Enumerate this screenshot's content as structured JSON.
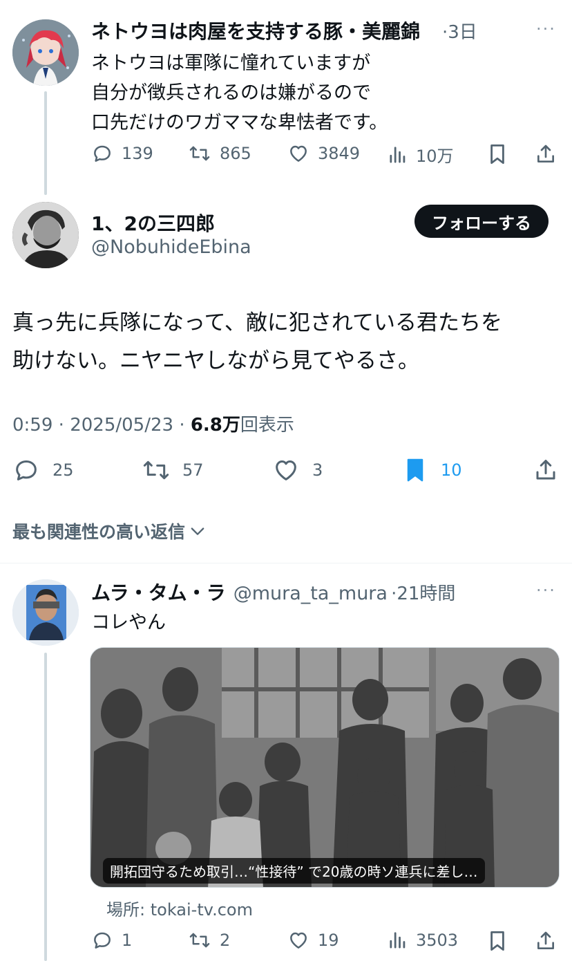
{
  "reply1": {
    "display_name": "ネトウヨは肉屋を支持する豚・美麗錦",
    "time": "3日",
    "more": "···",
    "text_lines": [
      "ネトウヨは軍隊に憧れていますが",
      "自分が徴兵されるのは嫌がるので",
      "口先だけのワガママな卑怯者です。"
    ],
    "replies": "139",
    "reposts": "865",
    "likes": "3849",
    "views": "10万"
  },
  "main": {
    "display_name": "1、2の三四郎",
    "handle": "@NobuhideEbina",
    "follow_label": "フォローする",
    "text_lines": [
      "真っ先に兵隊になって、敵に犯されている君たちを",
      "助けない。ニヤニヤしながら見てやるさ。"
    ],
    "time": "0:59",
    "date": "2025/05/23",
    "views_count": "6.8万",
    "views_label": "回表示",
    "replies": "25",
    "reposts": "57",
    "likes": "3",
    "bookmarks": "10",
    "bookmark_color": "#1d9bf0"
  },
  "sort": {
    "label": "最も関連性の高い返信"
  },
  "reply2": {
    "display_name": "ムラ・タム・ラ",
    "handle": "@mura_ta_mura",
    "time": "21時間",
    "more": "···",
    "text": "コレやん",
    "media_caption": "開拓団守るため取引…“性接待” で20歳の時ソ連兵に差し…",
    "link_prefix": "場所: ",
    "link_domain": "tokai-tv.com",
    "replies": "1",
    "reposts": "2",
    "likes": "19",
    "views": "3503"
  }
}
